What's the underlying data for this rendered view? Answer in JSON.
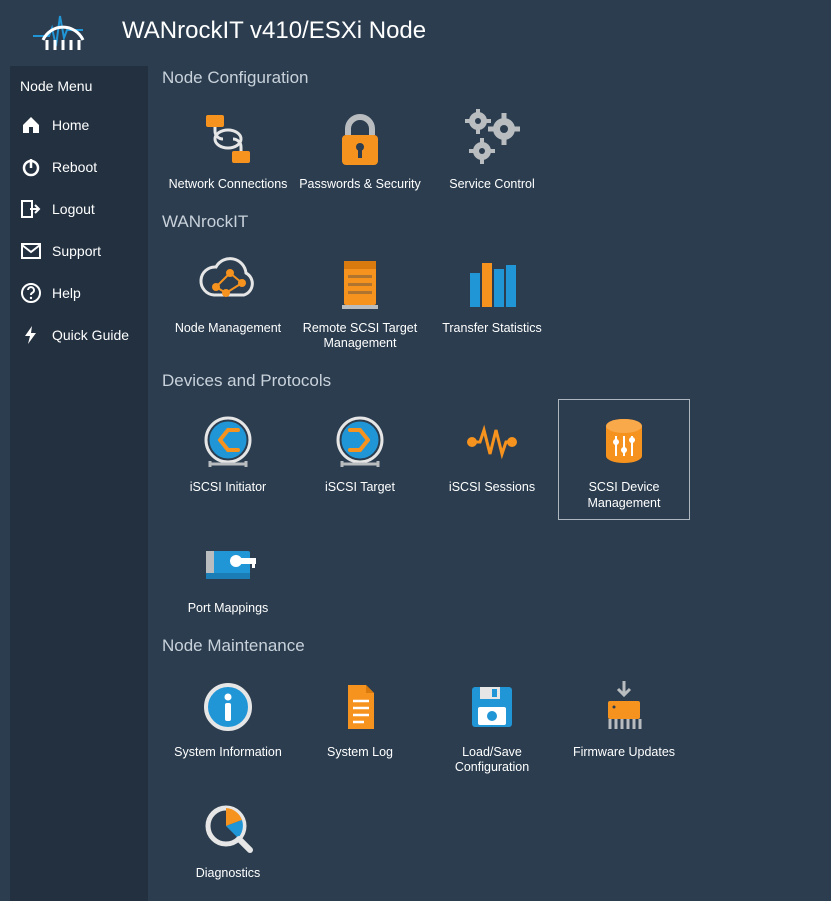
{
  "header": {
    "title": "WANrockIT v410/ESXi Node"
  },
  "sidebar": {
    "title": "Node Menu",
    "items": [
      {
        "label": "Home",
        "icon": "home-icon"
      },
      {
        "label": "Reboot",
        "icon": "power-icon"
      },
      {
        "label": "Logout",
        "icon": "logout-icon"
      },
      {
        "label": "Support",
        "icon": "envelope-icon"
      },
      {
        "label": "Help",
        "icon": "question-icon"
      },
      {
        "label": "Quick Guide",
        "icon": "bolt-icon"
      }
    ]
  },
  "sections": [
    {
      "title": "Node Configuration",
      "items": [
        {
          "label": "Network Connections",
          "icon": "network-icon"
        },
        {
          "label": "Passwords & Security",
          "icon": "padlock-icon"
        },
        {
          "label": "Service Control",
          "icon": "gears-icon"
        }
      ]
    },
    {
      "title": "WANrockIT",
      "items": [
        {
          "label": "Node Management",
          "icon": "cloud-nodes-icon"
        },
        {
          "label": "Remote SCSI Target Management",
          "icon": "server-rack-icon"
        },
        {
          "label": "Transfer Statistics",
          "icon": "bar-chart-icon"
        }
      ]
    },
    {
      "title": "Devices and Protocols",
      "items": [
        {
          "label": "iSCSI Initiator",
          "icon": "iscsi-initiator-icon"
        },
        {
          "label": "iSCSI Target",
          "icon": "iscsi-target-icon"
        },
        {
          "label": "iSCSI Sessions",
          "icon": "sessions-wave-icon"
        },
        {
          "label": "SCSI Device Management",
          "icon": "database-sliders-icon",
          "selected": true
        },
        {
          "label": "Port Mappings",
          "icon": "card-key-icon"
        }
      ]
    },
    {
      "title": "Node Maintenance",
      "items": [
        {
          "label": "System Information",
          "icon": "info-circle-icon"
        },
        {
          "label": "System Log",
          "icon": "document-icon"
        },
        {
          "label": "Load/Save Configuration",
          "icon": "floppy-icon"
        },
        {
          "label": "Firmware Updates",
          "icon": "chip-download-icon"
        },
        {
          "label": "Diagnostics",
          "icon": "magnifier-chart-icon"
        }
      ]
    }
  ],
  "colors": {
    "bg": "#2b3d4f",
    "panel": "#223040",
    "orange": "#f6921e",
    "blue": "#2196d6",
    "grey": "#b9bdc0"
  }
}
